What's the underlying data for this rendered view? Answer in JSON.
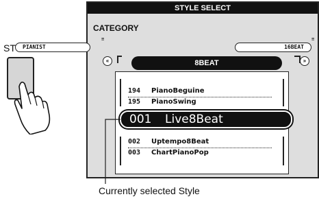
{
  "side": {
    "style_label": "STYLE",
    "button_name": "style-button"
  },
  "lcd": {
    "title": "STYLE SELECT",
    "category_label": "CATEGORY",
    "prev_category": "PIANIST",
    "next_category": "16BEAT",
    "current_category": "8BEAT",
    "tab_marker": "≡",
    "list": [
      {
        "num": "194",
        "name": "PianoBeguine"
      },
      {
        "num": "195",
        "name": "PianoSwing"
      },
      {
        "num": "002",
        "name": "Uptempo8Beat"
      },
      {
        "num": "003",
        "name": "ChartPianoPop"
      }
    ],
    "selected": {
      "num": "001",
      "name": "Live8Beat"
    }
  },
  "caption": "Currently selected Style"
}
